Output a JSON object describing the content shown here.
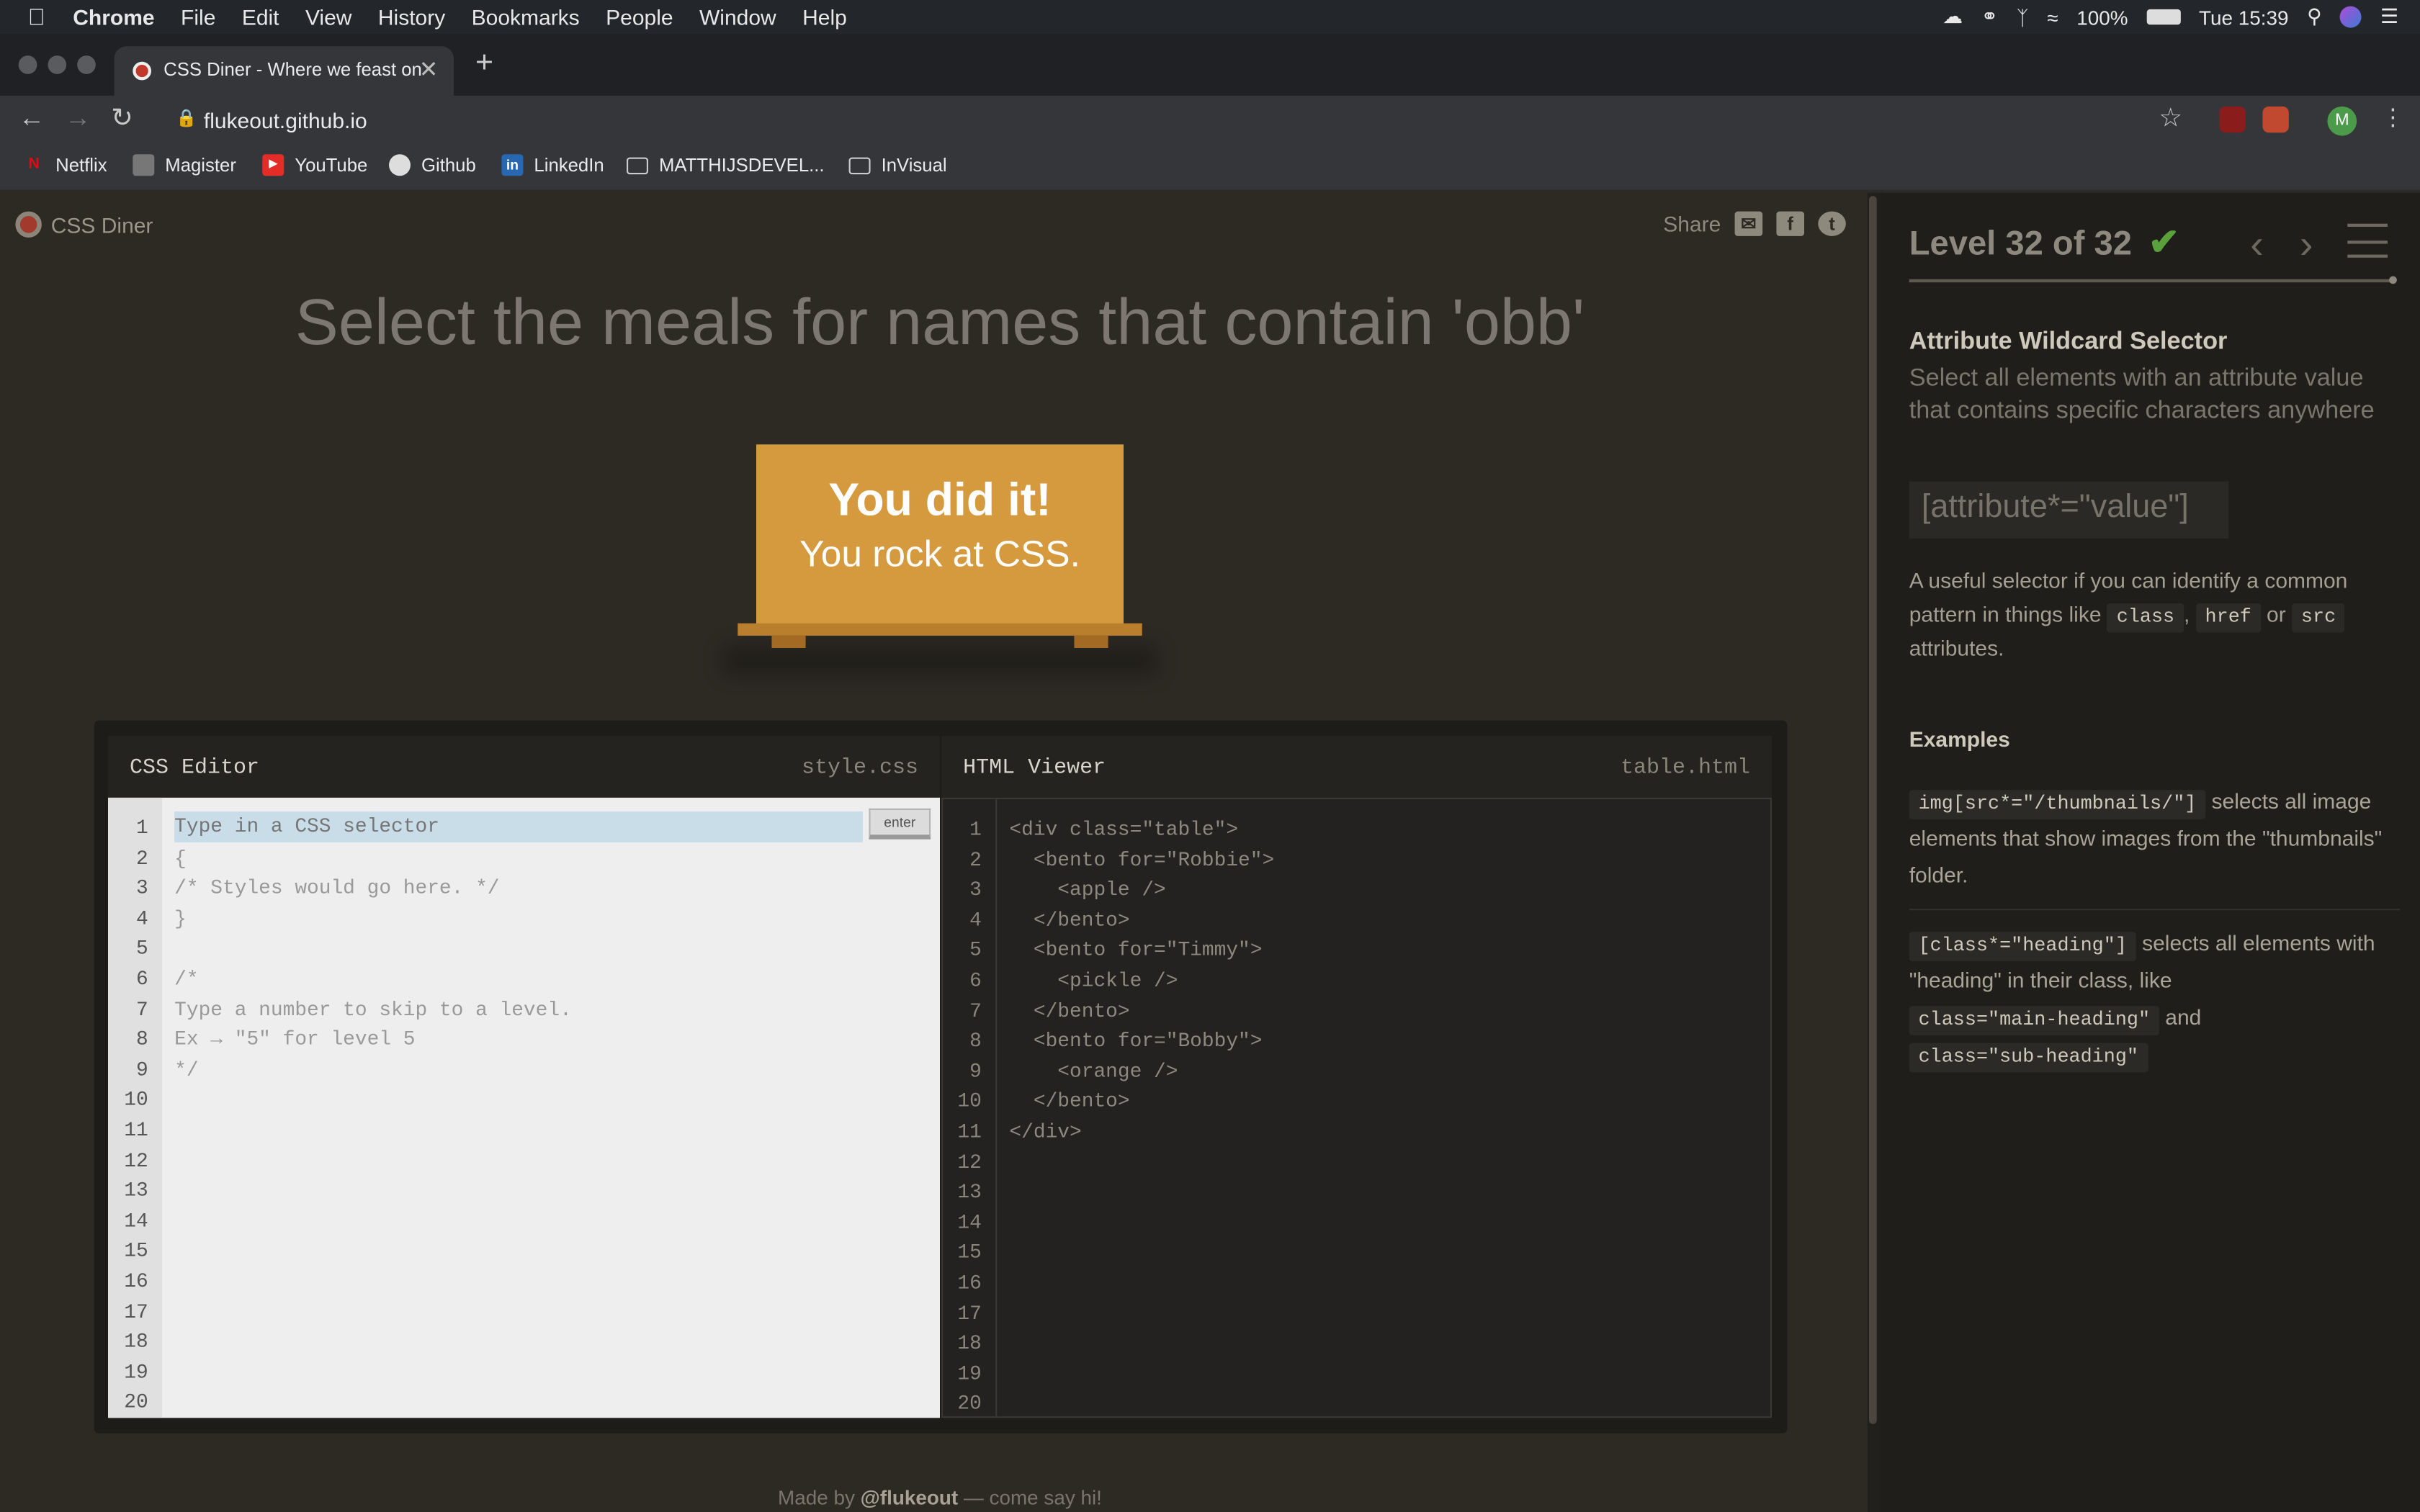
{
  "menubar": {
    "app": "Chrome",
    "items": [
      "File",
      "Edit",
      "View",
      "History",
      "Bookmarks",
      "People",
      "Window",
      "Help"
    ],
    "battery": "100%",
    "clock": "Tue 15:39"
  },
  "tab": {
    "title": "CSS Diner - Where we feast on",
    "new_tab": "+"
  },
  "toolbar": {
    "url": "flukeout.github.io",
    "avatar": "M"
  },
  "bookmarks": [
    {
      "label": "Netflix",
      "icon": "netflix-icon",
      "color": "#e50914"
    },
    {
      "label": "Magister",
      "icon": "magister-icon",
      "color": "#888888"
    },
    {
      "label": "YouTube",
      "icon": "youtube-icon",
      "color": "#ff0000"
    },
    {
      "label": "Github",
      "icon": "github-icon",
      "color": "#dddddd"
    },
    {
      "label": "LinkedIn",
      "icon": "linkedin-icon",
      "color": "#2867b2"
    },
    {
      "label": "MATTHIJSDEVEL...",
      "icon": "folder-icon",
      "color": "#cccccc"
    },
    {
      "label": "InVisual",
      "icon": "folder-icon",
      "color": "#cccccc"
    }
  ],
  "page": {
    "logo": "CSS Diner",
    "share": "Share",
    "headline": "Select the meals for names that contain 'obb'",
    "win_line1": "You did it!",
    "win_line2": "You rock at CSS.",
    "footer_pre": "Made by",
    "footer_handle": "@flukeout",
    "footer_post": "— come say hi!"
  },
  "css_editor": {
    "title": "CSS Editor",
    "file": "style.css",
    "placeholder": "Type in a CSS selector",
    "enter": "enter",
    "lines": [
      "",
      "{",
      "/* Styles would go here. */",
      "}",
      "",
      "/*",
      "Type a number to skip to a level.",
      "Ex → \"5\" for level 5",
      "*/",
      "",
      "",
      "",
      "",
      "",
      "",
      "",
      "",
      "",
      "",
      ""
    ]
  },
  "html_viewer": {
    "title": "HTML Viewer",
    "file": "table.html",
    "lines": [
      "<div class=\"table\">",
      "  <bento for=\"Robbie\">",
      "    <apple />",
      "  </bento>",
      "  <bento for=\"Timmy\">",
      "    <pickle />",
      "  </bento>",
      "  <bento for=\"Bobby\">",
      "    <orange />",
      "  </bento>",
      "</div>",
      "",
      "",
      "",
      "",
      "",
      "",
      "",
      "",
      ""
    ]
  },
  "line_numbers": [
    "1",
    "2",
    "3",
    "4",
    "5",
    "6",
    "7",
    "8",
    "9",
    "10",
    "11",
    "12",
    "13",
    "14",
    "15",
    "16",
    "17",
    "18",
    "19",
    "20"
  ],
  "sidebar": {
    "level": "Level 32 of 32",
    "check": "✔",
    "selector_name": "Attribute Wildcard Selector",
    "selector_desc": "Select all elements with an attribute value that contains specific characters anywhere",
    "syntax": "[attribute*=\"value\"]",
    "hint_1": "A useful selector if you can identify a common pattern in things like",
    "hint_code_1": "class",
    "hint_sep": ",",
    "hint_code_2": "href",
    "hint_or": "or",
    "hint_code_3": "src",
    "hint_2": "attributes.",
    "examples_title": "Examples",
    "ex1_code": "img[src*=\"/thumbnails/\"]",
    "ex1_text": "selects all image elements that show images from the \"thumbnails\" folder.",
    "ex2_code": "[class*=\"heading\"]",
    "ex2_text_1": "selects all elements with \"heading\" in their class, like",
    "ex2_code_2": "class=\"main-heading\"",
    "ex2_and": "and",
    "ex2_code_3": "class=\"sub-heading\""
  }
}
